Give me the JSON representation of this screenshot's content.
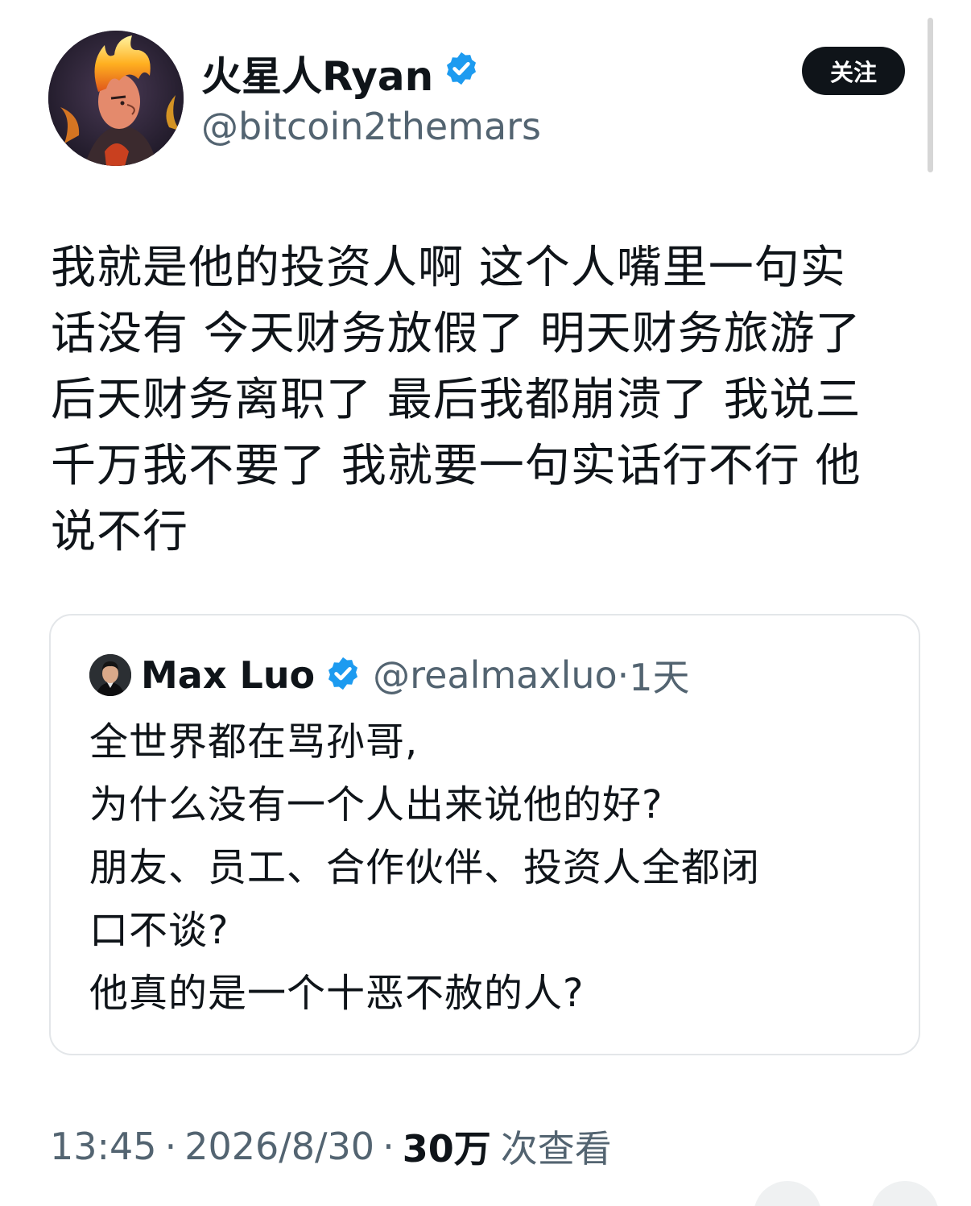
{
  "author": {
    "name": "火星人Ryan",
    "handle": "@bitcoin2themars",
    "verified": true,
    "avatar_icon": "flame-haired-character-avatar"
  },
  "follow_button": {
    "label": "关注"
  },
  "tweet": {
    "lines": [
      "我就是他的投资人啊 这个人嘴里一句实",
      "话没有 今天财务放假了 明天财务旅游了",
      "后天财务离职了 最后我都崩溃了 我说三",
      "千万我不要了 我就要一句实话行不行 他",
      "说不行"
    ]
  },
  "quote": {
    "name": "Max Luo",
    "handle": "@realmaxluo",
    "separator": "·",
    "time": "1天",
    "verified": true,
    "avatar_icon": "person-avatar",
    "lines": [
      "全世界都在骂孙哥,",
      "为什么没有一个人出来说他的好?",
      "朋友、员工、合作伙伴、投资人全都闭",
      "口不谈?",
      "他真的是一个十恶不赦的人?"
    ]
  },
  "meta": {
    "time": "13:45",
    "date": "2026/8/30",
    "separator": "·",
    "views_count": "30万",
    "views_label": "次查看"
  },
  "colors": {
    "verified_blue": "#1d9bf0",
    "text_primary": "#0f1419",
    "text_secondary": "#536471",
    "border": "#e3e6e9"
  }
}
